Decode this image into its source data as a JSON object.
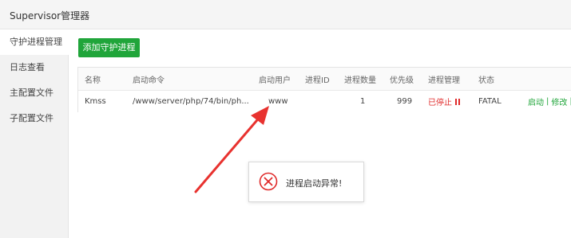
{
  "app": {
    "title": "Supervisor管理器"
  },
  "sidebar": {
    "items": [
      {
        "label": "守护进程管理",
        "active": true
      },
      {
        "label": "日志查看",
        "active": false
      },
      {
        "label": "主配置文件",
        "active": false
      },
      {
        "label": "子配置文件",
        "active": false
      }
    ]
  },
  "toolbar": {
    "add_label": "添加守护进程"
  },
  "table": {
    "headers": {
      "name": "名称",
      "command": "启动命令",
      "user": "启动用户",
      "pid": "进程ID",
      "count": "进程数量",
      "priority": "优先级",
      "manage": "进程管理",
      "status": "状态"
    },
    "rows": [
      {
        "name": "Kmss",
        "command": "/www/server/php/74/bin/ph...",
        "user": "www",
        "pid": "",
        "count": "1",
        "priority": "999",
        "manage": "已停止",
        "status": "FATAL",
        "actions": {
          "start": "启动",
          "sep": "|",
          "edit": "修改",
          "sep2": "|"
        }
      }
    ]
  },
  "toast": {
    "message": "进程启动异常!"
  },
  "colors": {
    "brand": "#20a53a",
    "error": "#e02a2a"
  }
}
